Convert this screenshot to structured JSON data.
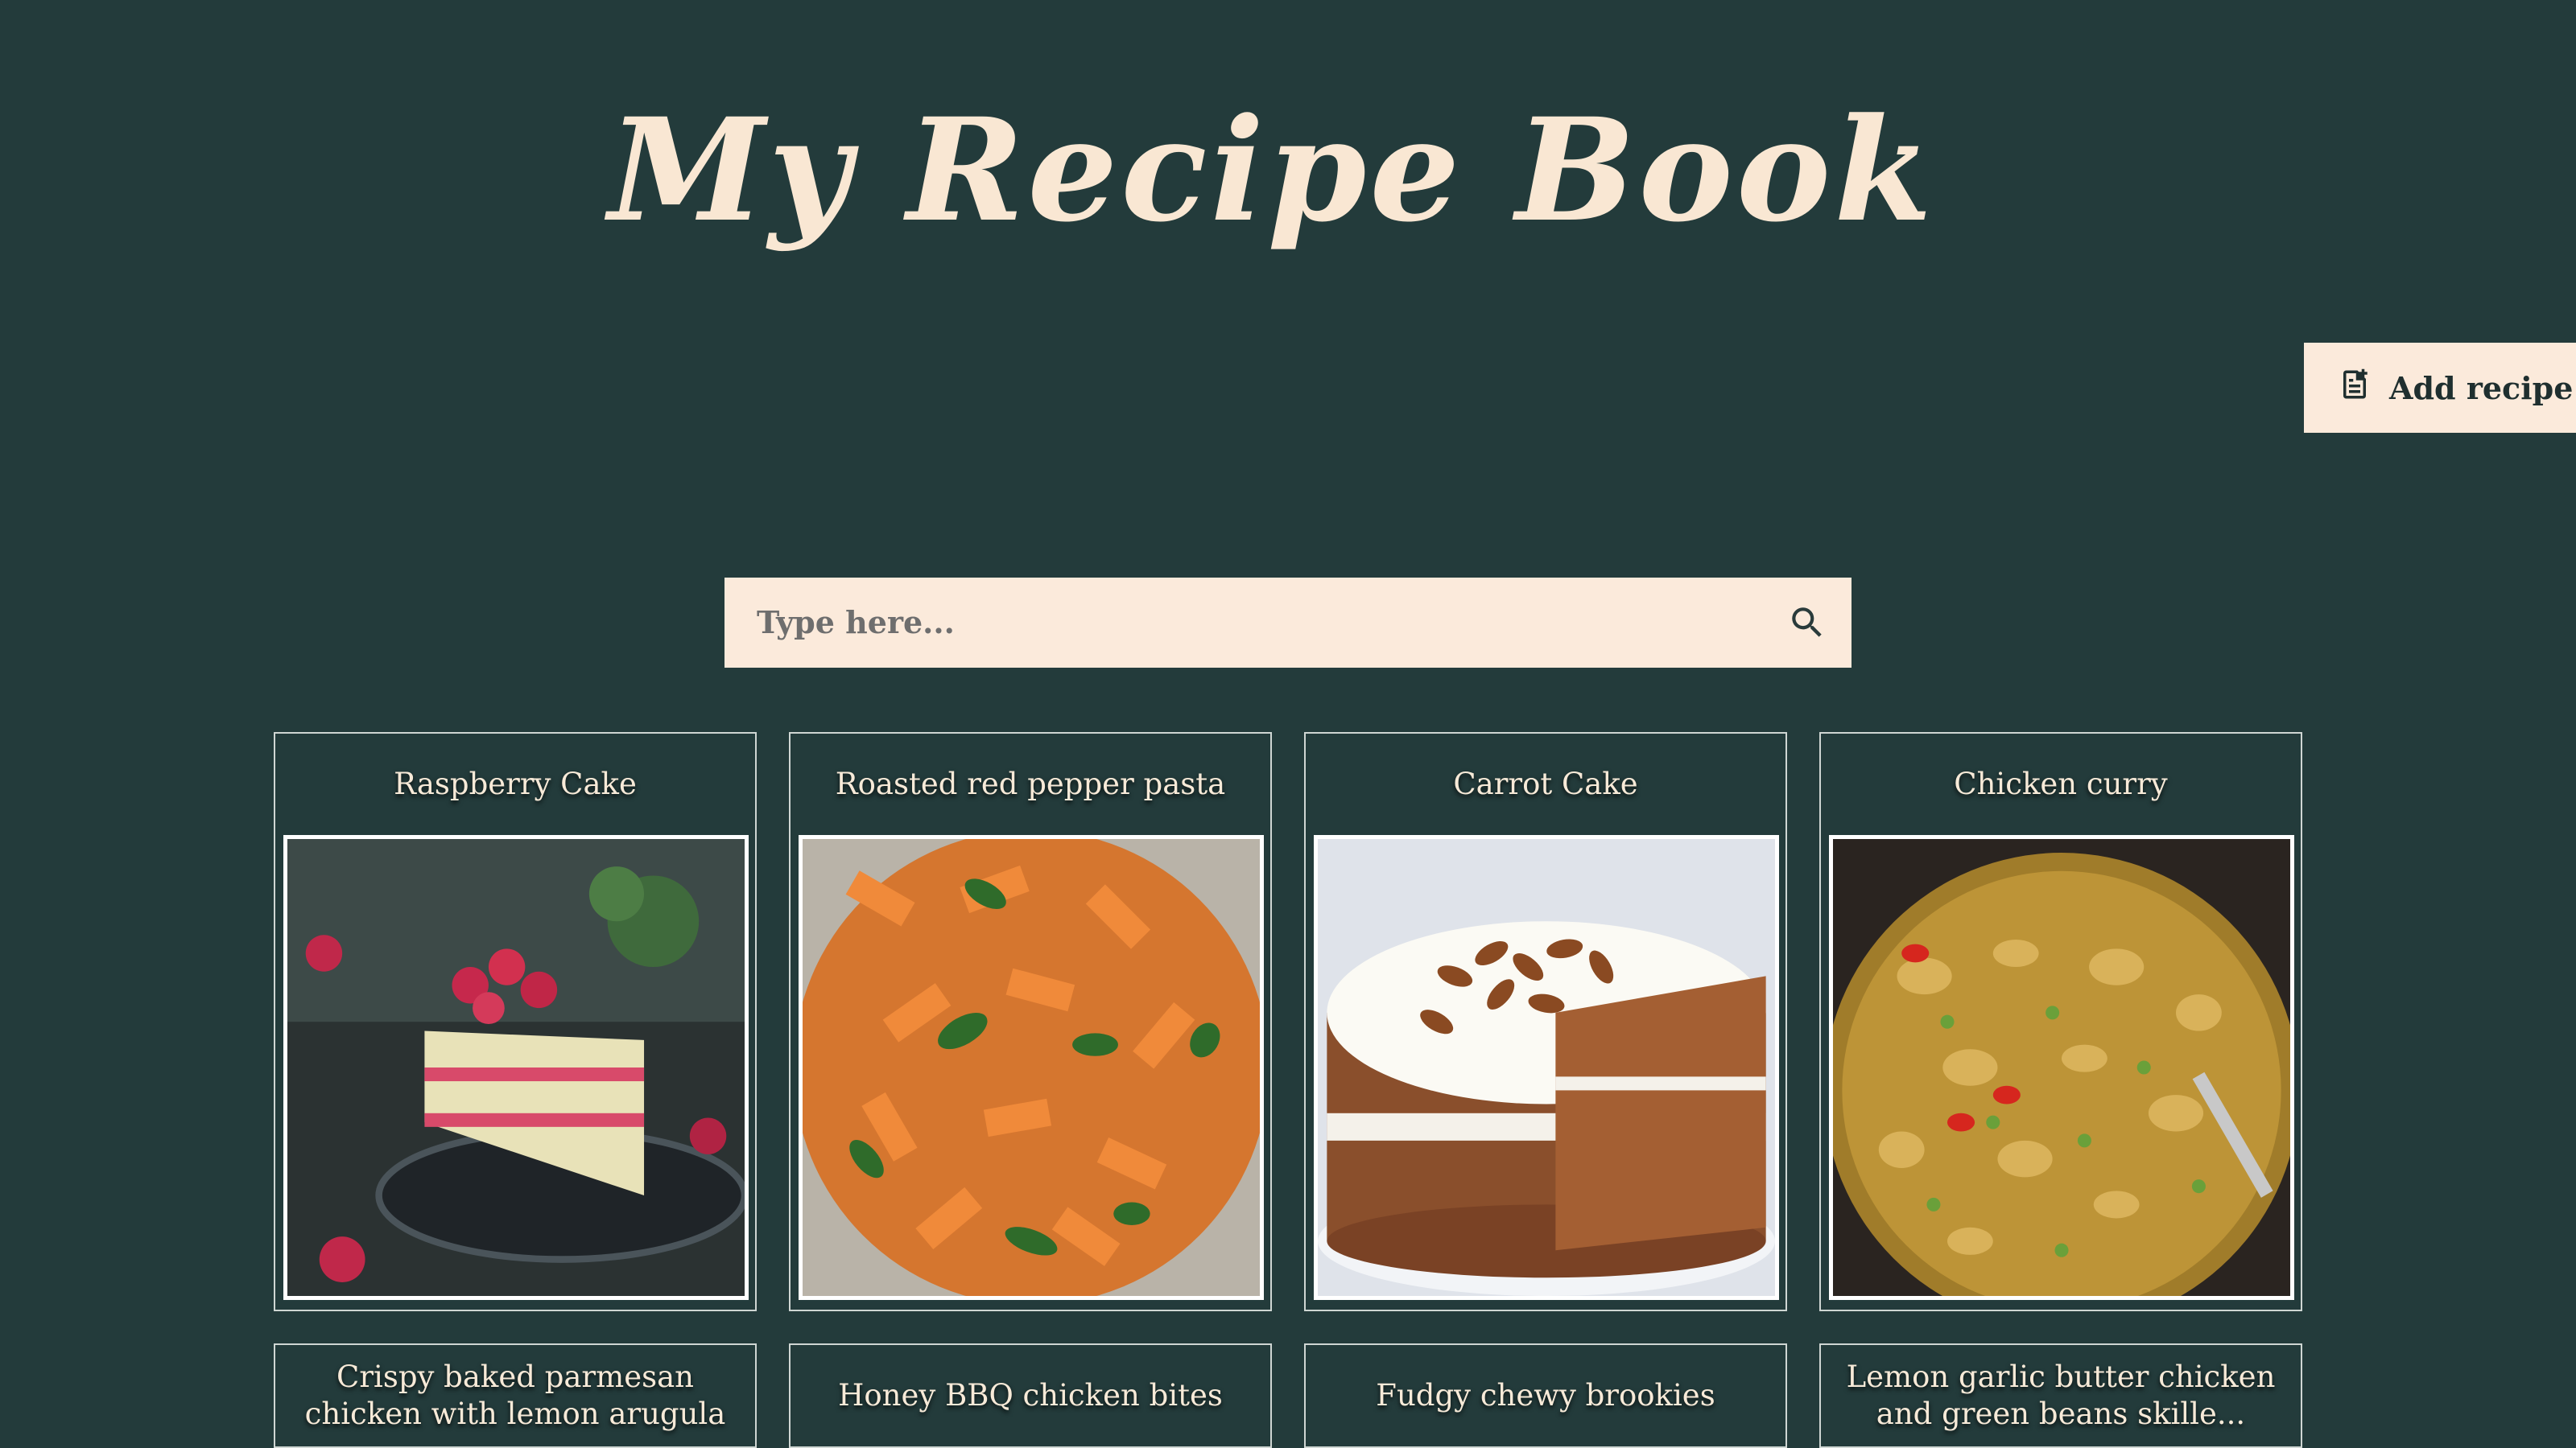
{
  "header": {
    "title": "My Recipe Book"
  },
  "actions": {
    "add_recipe_label": "Add recipe",
    "add_icon": "note-add-icon"
  },
  "search": {
    "placeholder": "Type here...",
    "icon": "search-icon"
  },
  "colors": {
    "background": "#233b3b",
    "cream": "#fbeadb",
    "text": "#f7e9d6"
  },
  "recipes": [
    {
      "title": "Raspberry Cake",
      "image": "raspberry-cake-photo"
    },
    {
      "title": "Roasted red pepper pasta",
      "image": "red-pepper-pasta-photo"
    },
    {
      "title": "Carrot Cake",
      "image": "carrot-cake-photo"
    },
    {
      "title": "Chicken curry",
      "image": "chicken-curry-photo"
    },
    {
      "title": "Crispy baked parmesan chicken with lemon arugula"
    },
    {
      "title": "Honey BBQ chicken bites"
    },
    {
      "title": "Fudgy chewy brookies"
    },
    {
      "title": "Lemon garlic butter chicken and green beans skille..."
    }
  ]
}
